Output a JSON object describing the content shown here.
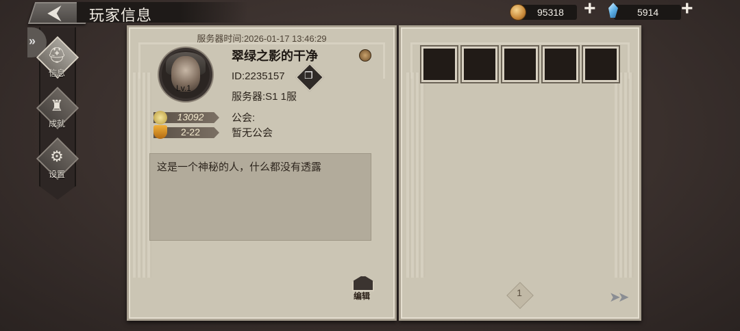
{
  "header": {
    "back_icon": "back-arrow-icon",
    "title": "玩家信息",
    "gold": "95318",
    "gems": "5914"
  },
  "nav": {
    "items": [
      {
        "label": "信息",
        "icon": "helmet-icon",
        "active": true
      },
      {
        "label": "成就",
        "icon": "castle-icon",
        "active": false
      },
      {
        "label": "设置",
        "icon": "gear-icon",
        "active": false
      }
    ]
  },
  "profile": {
    "server_time": "服务器时间:2026-01-17 13:46:29",
    "name": "翠绿之影的干净",
    "level": "Lv.1",
    "id": "ID:2235157",
    "server": "服务器:S1 1服",
    "power": "13092",
    "stage": "2-22",
    "guild_label": "公会:",
    "guild_value": "暂无公会",
    "bio": "这是一个神秘的人，什么都没有透露",
    "edit_label": "编辑"
  },
  "right_panel": {
    "slots": [
      "",
      "",
      "",
      "",
      ""
    ],
    "page": "1"
  },
  "colors": {
    "panel": "#cbc5b4",
    "slot_bg": "#211b17",
    "background": "#3a302d"
  }
}
